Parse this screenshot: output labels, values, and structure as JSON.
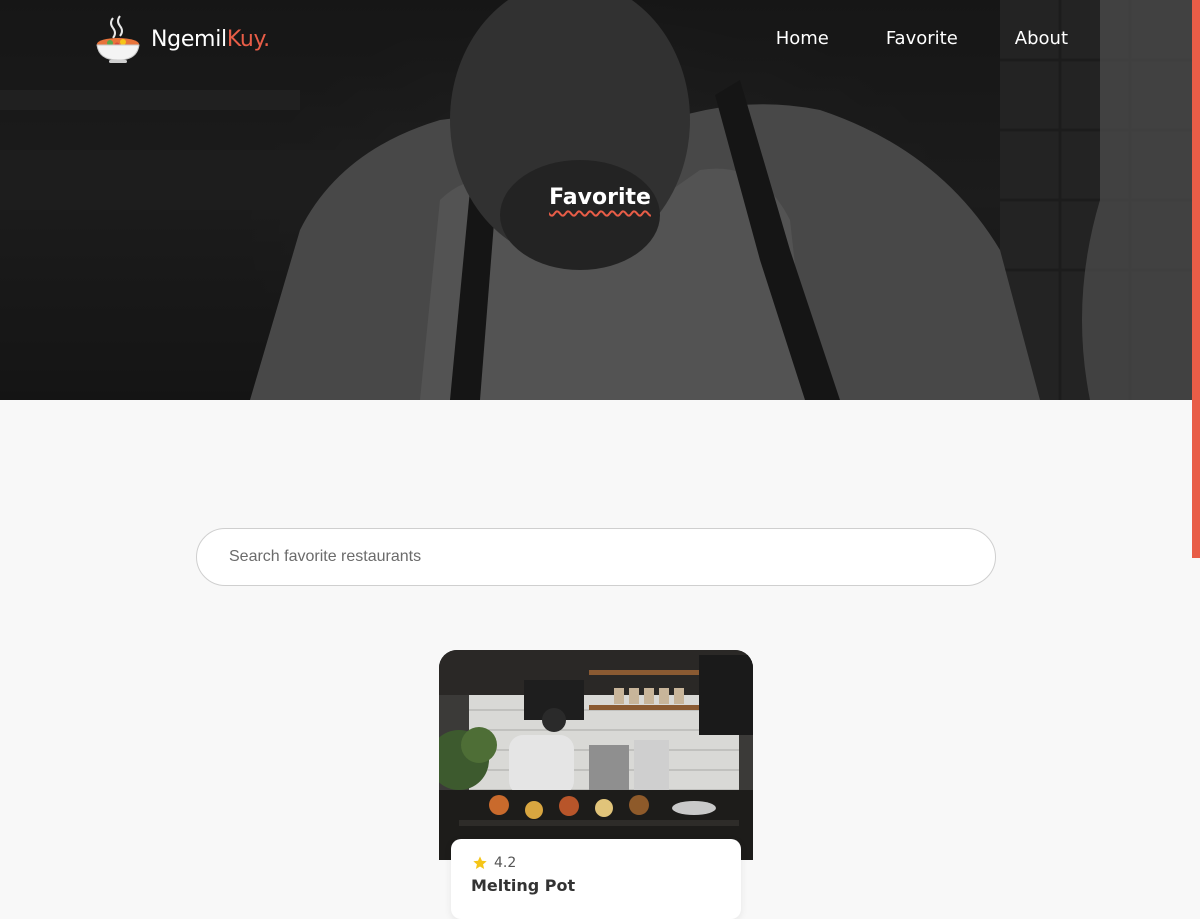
{
  "brand": {
    "name_main": "Ngemil",
    "name_accent": "Kuy.",
    "icon": "food-bowl-icon"
  },
  "nav": {
    "items": [
      {
        "label": "Home"
      },
      {
        "label": "Favorite"
      },
      {
        "label": "About"
      }
    ]
  },
  "hero": {
    "title": "Favorite"
  },
  "search": {
    "placeholder": "Search favorite restaurants",
    "value": ""
  },
  "restaurants": [
    {
      "name": "Melting Pot",
      "rating": "4.2",
      "rating_icon": "star-icon"
    }
  ],
  "colors": {
    "accent": "#e85d47",
    "star": "#f5c518",
    "hero_overlay": "#1e1e1e",
    "page_bg": "#f8f8f8"
  }
}
